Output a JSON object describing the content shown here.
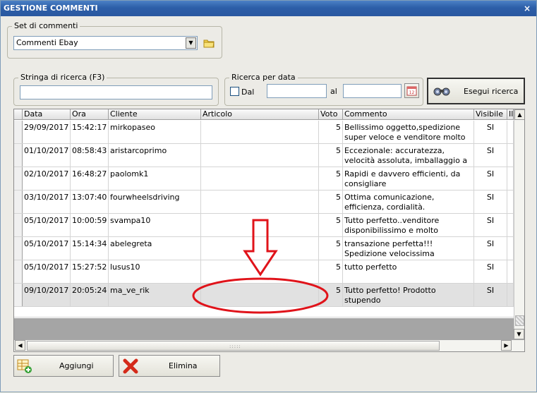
{
  "window": {
    "title": "GESTIONE COMMENTI",
    "close_glyph": "×"
  },
  "set": {
    "label": "Set di commenti",
    "selected": "Commenti Ebay",
    "dropdown_glyph": "▼",
    "folder_icon": "folder-icon"
  },
  "search": {
    "label": "Stringa di ricerca (F3)",
    "value": ""
  },
  "date_search": {
    "label": "Ricerca per data",
    "dal_label": "Dal",
    "al_label": "al",
    "dal_value": "",
    "al_value": "",
    "calendar_icon": "calendar-icon"
  },
  "execute_button": {
    "label": "Esegui ricerca",
    "icon": "binoculars-icon"
  },
  "table": {
    "columns": [
      "Data",
      "Ora",
      "Cliente",
      "Articolo",
      "Voto",
      "Commento",
      "Visibile",
      "Il"
    ],
    "rows": [
      {
        "data": "29/09/2017",
        "ora": "15:42:17",
        "cliente": "mirkopaseo",
        "articolo": "",
        "voto": "5",
        "commento": "Bellissimo oggetto,spedizione super veloce e venditore molto cortese.C...",
        "visibile": "SI"
      },
      {
        "data": "01/10/2017",
        "ora": "08:58:43",
        "cliente": "aristarcoprimo",
        "articolo": "",
        "voto": "5",
        "commento": "Eccezionale: accuratezza, velocità assoluta, imballaggio a prova di bo...",
        "visibile": "SI"
      },
      {
        "data": "02/10/2017",
        "ora": "16:48:27",
        "cliente": "paolomk1",
        "articolo": "",
        "voto": "5",
        "commento": "Rapidi e davvero efficienti, da consigliare",
        "visibile": "SI"
      },
      {
        "data": "03/10/2017",
        "ora": "13:07:40",
        "cliente": "fourwheelsdriving",
        "articolo": "",
        "voto": "5",
        "commento": "Ottima comunicazione, efficienza, cordialità. Professionalità.",
        "visibile": "SI"
      },
      {
        "data": "05/10/2017",
        "ora": "10:00:59",
        "cliente": "svampa10",
        "articolo": "",
        "voto": "5",
        "commento": "Tutto perfetto..venditore disponibilissimo e molto paziente..c...",
        "visibile": "SI"
      },
      {
        "data": "05/10/2017",
        "ora": "15:14:34",
        "cliente": "abelegreta",
        "articolo": "",
        "voto": "5",
        "commento": "transazione perfetta!!! Spedizione velocissima",
        "visibile": "SI"
      },
      {
        "data": "05/10/2017",
        "ora": "15:27:52",
        "cliente": "lusus10",
        "articolo": "",
        "voto": "5",
        "commento": "tutto perfetto",
        "visibile": "SI"
      },
      {
        "data": "09/10/2017",
        "ora": "20:05:24",
        "cliente": "ma_ve_rik",
        "articolo": "",
        "voto": "5",
        "commento": "Tutto perfetto! Prodotto stupendo",
        "visibile": "SI"
      }
    ],
    "selected_row": 7
  },
  "scroll": {
    "up": "▲",
    "down": "▼",
    "left": "◀",
    "right": "▶"
  },
  "buttons": {
    "add": {
      "label": "Aggiungi",
      "icon": "add-grid-icon"
    },
    "delete": {
      "label": "Elimina",
      "icon": "delete-x-icon"
    }
  },
  "colors": {
    "annotation": "#e0131a",
    "titlebar": "#2c5ea8"
  }
}
